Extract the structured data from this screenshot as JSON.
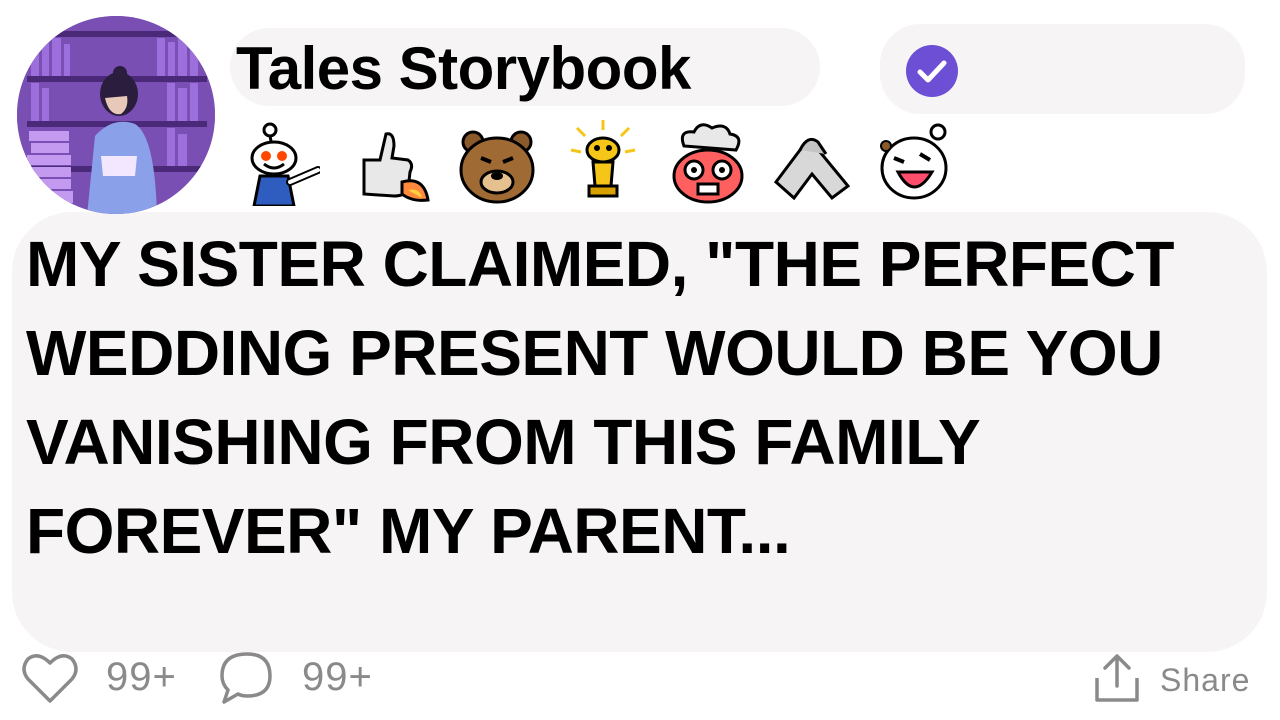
{
  "post": {
    "author": {
      "display_name": "Tales Storybook",
      "verified": true
    },
    "awards": [
      "pointing-snoo-icon",
      "rocket-thumbs-up-icon",
      "bear-icon",
      "golden-trophy-snoo-icon",
      "mind-blown-icon",
      "handshake-icon",
      "laughing-snoo-icon"
    ],
    "headline": "MY SISTER CLAIMED, \"THE PERFECT WEDDING PRESENT WOULD BE YOU VANISHING FROM THIS FAMILY FOREVER\" MY PARENT...",
    "footer": {
      "likes": "99+",
      "comments": "99+",
      "share_label": "Share"
    }
  },
  "colors": {
    "verified_badge": "#6c4fd4",
    "muted_text": "#8a8a8a",
    "background": "#ffffff"
  }
}
